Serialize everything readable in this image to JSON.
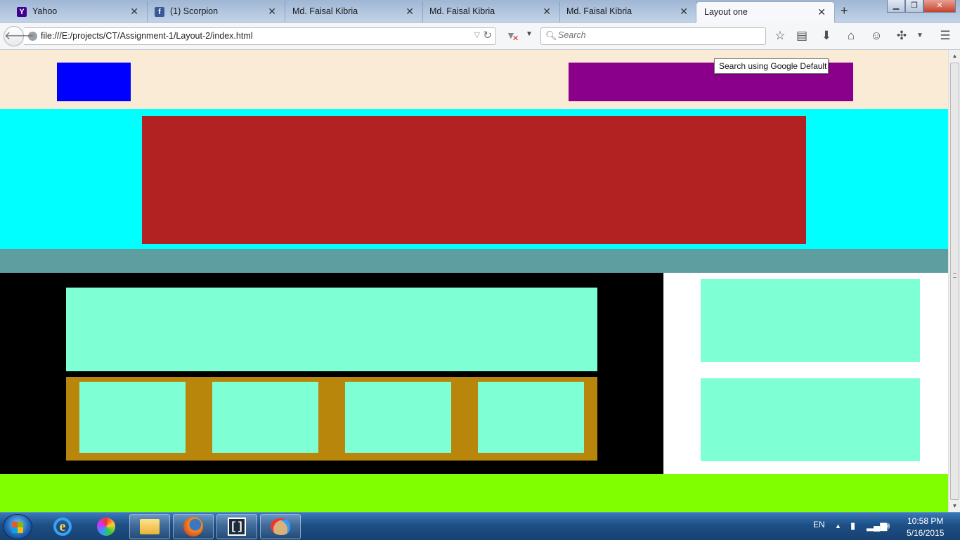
{
  "browser": {
    "tabs": [
      {
        "title": "Yahoo",
        "icon": "yahoo-icon",
        "icon_char": "Y",
        "icon_color": "#400090"
      },
      {
        "title": "(1) Scorpion",
        "icon": "facebook-icon",
        "icon_char": "f",
        "icon_color": "#3b5998"
      },
      {
        "title": "Md. Faisal Kibria",
        "icon": "",
        "icon_char": "",
        "icon_color": ""
      },
      {
        "title": "Md. Faisal Kibria",
        "icon": "",
        "icon_char": "",
        "icon_color": ""
      },
      {
        "title": "Md. Faisal Kibria",
        "icon": "",
        "icon_char": "",
        "icon_color": ""
      },
      {
        "title": "Layout one",
        "icon": "",
        "icon_char": "",
        "icon_color": "",
        "active": true
      }
    ],
    "tab_close_glyph": "✕",
    "new_tab_glyph": "+",
    "window_controls": {
      "minimize": "▁",
      "maximize": "❐",
      "close": "✕"
    },
    "url": "file:///E:/projects/CT/Assignment-1/Layout-2/index.html",
    "search_placeholder": "Search",
    "tooltip": "Search using Google Default",
    "toolbar_icons": [
      "star-icon",
      "reading-list-icon",
      "download-icon",
      "home-icon",
      "hello-icon",
      "addon-icon",
      "overflow-dropdown-icon",
      "menu-icon"
    ]
  },
  "page": {
    "colors": {
      "header_bg": "#faebd7",
      "logo": "#0000ff",
      "nav": "#8b008b",
      "banner_bg": "#00ffff",
      "banner": "#b22222",
      "strip": "#5f9ea0",
      "main_bg": "#000000",
      "panel": "#7fffd4",
      "card_row": "#b8860b",
      "aside_bg": "#ffffff",
      "footer": "#7fff00"
    }
  },
  "taskbar": {
    "pinned_apps": [
      "internet-explorer-icon",
      "paint-icon",
      "file-explorer-icon",
      "firefox-icon",
      "brackets-icon",
      "paint-palette-icon"
    ],
    "language": "EN",
    "time": "10:58 PM",
    "date": "5/16/2015"
  }
}
